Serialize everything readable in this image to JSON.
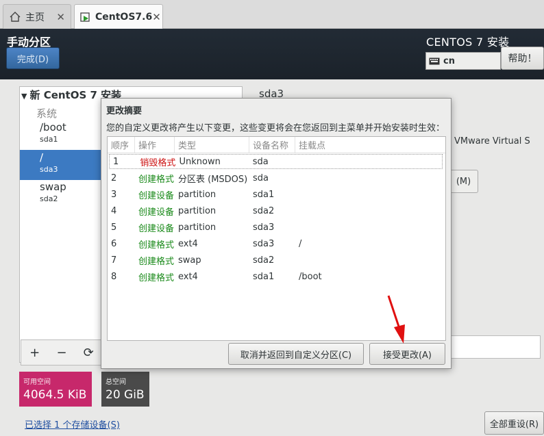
{
  "tabs": [
    {
      "label": "主页",
      "icon": "home-icon"
    },
    {
      "label": "CentOS7.6",
      "icon": "vm-icon"
    }
  ],
  "header": {
    "title": "手动分区",
    "done_label": "完成(D)",
    "product": "CENTOS 7 安装",
    "keyboard_layout": "cn",
    "help_label": "帮助！"
  },
  "left_panel": {
    "heading": "新 CentOS 7 安装",
    "group": "系统",
    "items": [
      {
        "name": "/boot",
        "device": "sda1"
      },
      {
        "name": "/",
        "device": "sda3"
      },
      {
        "name": "swap",
        "device": "sda2"
      }
    ],
    "tools": [
      "+",
      "−",
      "⟳"
    ]
  },
  "detail": {
    "device_title": "sda3",
    "device_desc": "VMware Virtual S",
    "modify_label": "(M)"
  },
  "storage": {
    "free_label": "可用空间",
    "free_value": "4064.5 KiB",
    "total_label": "总空间",
    "total_value": "20 GiB",
    "selected_link": "已选择 1 个存储设备(S)",
    "reset_label": "全部重设(R)"
  },
  "dialog": {
    "title": "更改摘要",
    "description": "您的自定义更改将产生以下变更，这些变更将会在您返回到主菜单并开始安装时生效：",
    "columns": [
      "顺序",
      "操作",
      "类型",
      "设备名称",
      "挂载点"
    ],
    "rows": [
      {
        "order": "1",
        "action": "销毁格式",
        "kind": "destroy",
        "type": "Unknown",
        "device": "sda",
        "mount": ""
      },
      {
        "order": "2",
        "action": "创建格式",
        "kind": "create",
        "type": "分区表 (MSDOS)",
        "device": "sda",
        "mount": ""
      },
      {
        "order": "3",
        "action": "创建设备",
        "kind": "create",
        "type": "partition",
        "device": "sda1",
        "mount": ""
      },
      {
        "order": "4",
        "action": "创建设备",
        "kind": "create",
        "type": "partition",
        "device": "sda2",
        "mount": ""
      },
      {
        "order": "5",
        "action": "创建设备",
        "kind": "create",
        "type": "partition",
        "device": "sda3",
        "mount": ""
      },
      {
        "order": "6",
        "action": "创建格式",
        "kind": "create",
        "type": "ext4",
        "device": "sda3",
        "mount": "/"
      },
      {
        "order": "7",
        "action": "创建格式",
        "kind": "create",
        "type": "swap",
        "device": "sda2",
        "mount": ""
      },
      {
        "order": "8",
        "action": "创建格式",
        "kind": "create",
        "type": "ext4",
        "device": "sda1",
        "mount": "/boot"
      }
    ],
    "cancel_label": "取消并返回到自定义分区(C)",
    "accept_label": "接受更改(A)"
  },
  "colors": {
    "destroy": "#cc1111",
    "create": "#1a8a1a",
    "selection": "#3c7ac2",
    "free_space": "#c7286b",
    "arrow": "#e01010"
  }
}
